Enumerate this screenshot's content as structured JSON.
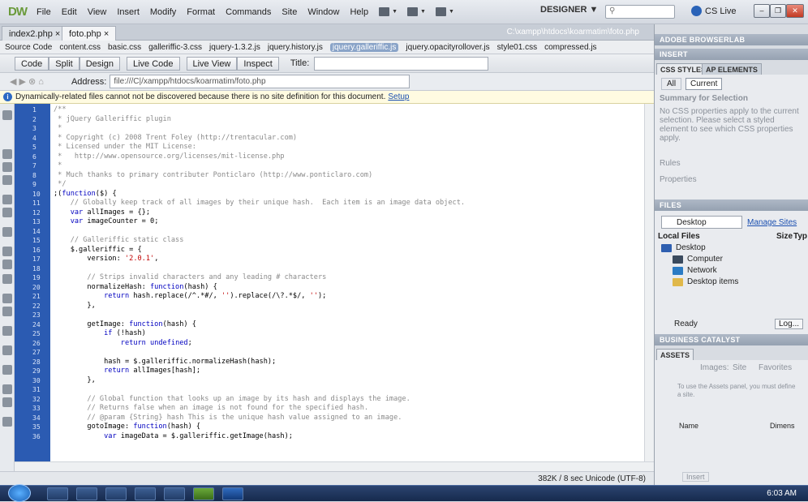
{
  "app": {
    "logo": "DW",
    "workspace": "DESIGNER ▼",
    "search_placeholder": "",
    "cs_live": "CS Live"
  },
  "menu": [
    "File",
    "Edit",
    "View",
    "Insert",
    "Modify",
    "Format",
    "Commands",
    "Site",
    "Window",
    "Help"
  ],
  "doc_tabs": [
    {
      "label": "index2.php ×"
    },
    {
      "label": "foto.php ×"
    }
  ],
  "doc_path": "C:\\xampp\\htdocs\\koarmatim\\foto.php",
  "related_files": [
    "Source Code",
    "content.css",
    "basic.css",
    "galleriffic-3.css",
    "jquery-1.3.2.js",
    "jquery.history.js",
    "jquery.galleriffic.js",
    "jquery.opacityrollover.js",
    "style01.css",
    "compressed.js"
  ],
  "view_buttons": {
    "code": "Code",
    "split": "Split",
    "design": "Design",
    "live_code": "Live Code",
    "live_view": "Live View",
    "inspect": "Inspect",
    "title_label": "Title:"
  },
  "address": {
    "label": "Address:",
    "value": "file:///C|/xampp/htdocs/koarmatim/foto.php"
  },
  "info": {
    "text": "Dynamically-related files cannot not be discovered because there is no site definition for this document.",
    "link": "Setup"
  },
  "code_lines": [
    "/**",
    " * jQuery Galleriffic plugin",
    " *",
    " * Copyright (c) 2008 Trent Foley (http://trentacular.com)",
    " * Licensed under the MIT License:",
    " *   http://www.opensource.org/licenses/mit-license.php",
    " *",
    " * Much thanks to primary contributer Ponticlaro (http://www.ponticlaro.com)",
    " */",
    ";(function($) {",
    "    // Globally keep track of all images by their unique hash.  Each item is an image data object.",
    "    var allImages = {};",
    "    var imageCounter = 0;",
    "",
    "    // Galleriffic static class",
    "    $.galleriffic = {",
    "        version: '2.0.1',",
    "",
    "        // Strips invalid characters and any leading # characters",
    "        normalizeHash: function(hash) {",
    "            return hash.replace(/^.*#/, '').replace(/\\?.*$/, '');",
    "        },",
    "",
    "        getImage: function(hash) {",
    "            if (!hash)",
    "                return undefined;",
    "",
    "            hash = $.galleriffic.normalizeHash(hash);",
    "            return allImages[hash];",
    "        },",
    "",
    "        // Global function that looks up an image by its hash and displays the image.",
    "        // Returns false when an image is not found for the specified hash.",
    "        // @param {String} hash This is the unique hash value assigned to an image.",
    "        gotoImage: function(hash) {",
    "            var imageData = $.galleriffic.getImage(hash);"
  ],
  "line_numbers": [
    "1",
    "2",
    "3",
    "4",
    "5",
    "6",
    "7",
    "8",
    "9",
    "10",
    "11",
    "12",
    "13",
    "14",
    "15",
    "16",
    "17",
    "18",
    "19",
    "20",
    "21",
    "22",
    "23",
    "24",
    "25",
    "26",
    "27",
    "28",
    "29",
    "30",
    "31",
    "32",
    "33",
    "34",
    "35",
    "36"
  ],
  "status": "382K / 8 sec  Unicode (UTF-8)",
  "panels": {
    "browserlab": "ADOBE BROWSERLAB",
    "insert": "INSERT",
    "css_tab": "CSS STYLES",
    "ap_tab": "AP ELEMENTS",
    "all_btn": "All",
    "current_btn": "Current",
    "summary": "Summary for Selection",
    "no_css": "No CSS properties apply to the current selection.  Please select a styled element to see which CSS properties apply.",
    "rules": "Rules",
    "properties": "Properties",
    "files": "FILES",
    "location": "Desktop",
    "manage": "Manage Sites",
    "local_files": "Local Files",
    "size_col": "Size",
    "type_col": "Typ",
    "tree": [
      "Desktop",
      "Computer",
      "Network",
      "Desktop items"
    ],
    "ready": "Ready",
    "log": "Log...",
    "business": "BUSINESS CATALYST",
    "assets": "ASSETS",
    "images_label": "Images:",
    "site_opt": "Site",
    "fav_opt": "Favorites",
    "assets_msg": "To use the Assets panel, you must define a site.",
    "name_col": "Name",
    "dims_col": "Dimens",
    "insert_btn": "Insert"
  },
  "clock": "6:03 AM"
}
